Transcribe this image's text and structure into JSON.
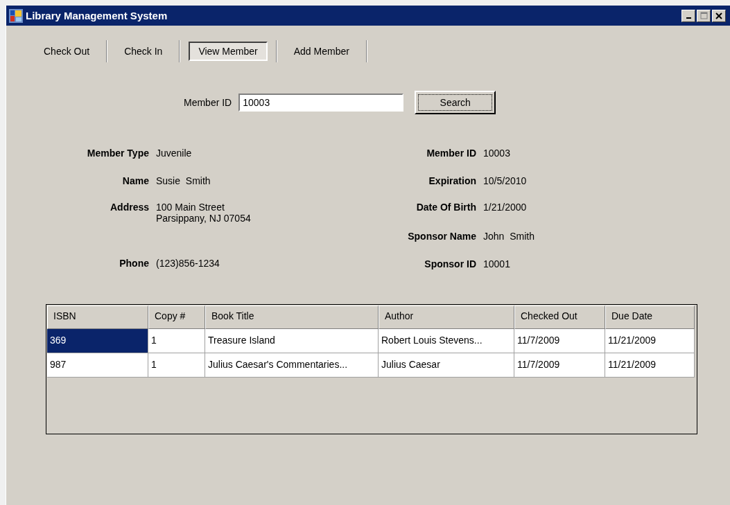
{
  "window": {
    "title": "Library Management System"
  },
  "tabs": [
    {
      "label": "Check Out",
      "selected": false
    },
    {
      "label": "Check In",
      "selected": false
    },
    {
      "label": "View Member",
      "selected": true
    },
    {
      "label": "Add Member",
      "selected": false
    }
  ],
  "search": {
    "label": "Member ID",
    "value": "10003",
    "button": "Search"
  },
  "details_left": [
    {
      "label": "Member Type",
      "value": "Juvenile"
    },
    {
      "label": "Name",
      "value": "Susie  Smith"
    },
    {
      "label": "Address",
      "value": "100 Main Street\nParsippany, NJ 07054"
    },
    {
      "label": "Phone",
      "value": "(123)856-1234"
    }
  ],
  "details_right": [
    {
      "label": "Member ID",
      "value": "10003"
    },
    {
      "label": "Expiration",
      "value": "10/5/2010"
    },
    {
      "label": "Date Of Birth",
      "value": "1/21/2000"
    },
    {
      "label": "Sponsor Name",
      "value": "John  Smith"
    },
    {
      "label": "Sponsor ID",
      "value": "10001"
    }
  ],
  "table": {
    "columns": [
      "ISBN",
      "Copy #",
      "Book Title",
      "Author",
      "Checked Out",
      "Due Date"
    ],
    "rows": [
      {
        "selected": true,
        "cells": [
          "369",
          "1",
          "Treasure Island",
          "Robert Louis Stevens...",
          "11/7/2009",
          "11/21/2009"
        ]
      },
      {
        "selected": false,
        "cells": [
          "987",
          "1",
          "Julius Caesar's Commentaries...",
          "Julius Caesar",
          "11/7/2009",
          "11/21/2009"
        ]
      }
    ]
  }
}
